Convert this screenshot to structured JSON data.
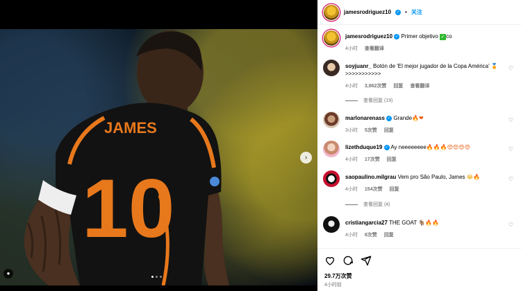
{
  "post": {
    "author": "jamesrodriguez10",
    "follow_label": "关注",
    "dot": "•",
    "jersey_name": "JAMES",
    "jersey_number": "10",
    "caption": {
      "user": "jamesrodriguez10",
      "text": "Primer objetivo ",
      "emoji": "✓",
      "after": "co",
      "time": "4小时",
      "translate": "查看翻译"
    }
  },
  "comments": [
    {
      "user": "soyjuanr_",
      "text": "Botón de 'El mejor jugador de la Copa América' 🏅 >>>>>>>>>>>",
      "time": "4小时",
      "likes": "3,862次赞",
      "reply": "回复",
      "translate": "查看翻译",
      "view_replies": "查看回复 (19)"
    },
    {
      "user": "marlonarenass",
      "verified": true,
      "text": "Grande",
      "emojis": "🔥❤",
      "time": "3小时",
      "likes": "5次赞",
      "reply": "回复"
    },
    {
      "user": "lizethduque19",
      "verified": true,
      "text": "Ay neeeeeeee",
      "emojis": "🔥🔥🔥😍😍😍😍",
      "time": "4小时",
      "likes": "17次赞",
      "reply": "回复"
    },
    {
      "user": "saopaulino.milgrau",
      "text": "Vem pro São Paulo, James",
      "emojis": "😂🔥",
      "time": "4小时",
      "likes": "154次赞",
      "reply": "回复",
      "view_replies": "查看回复 (4)"
    },
    {
      "user": "cristiangarcia27",
      "text": "THE GOAT",
      "emojis": "🐐🔥🔥",
      "time": "4小时",
      "likes": "8次赞",
      "reply": "回复"
    }
  ],
  "footer": {
    "likes": "29.7万次赞",
    "time": "4小时前"
  },
  "icons": {
    "like": "heart-icon",
    "comment": "comment-icon",
    "share": "share-icon",
    "next": "chevron-right-icon",
    "tag": "user-tag-icon"
  },
  "colors": {
    "link": "#0095f6",
    "muted": "#737373",
    "verified": "#0095f6",
    "jersey": "#e8781c"
  }
}
